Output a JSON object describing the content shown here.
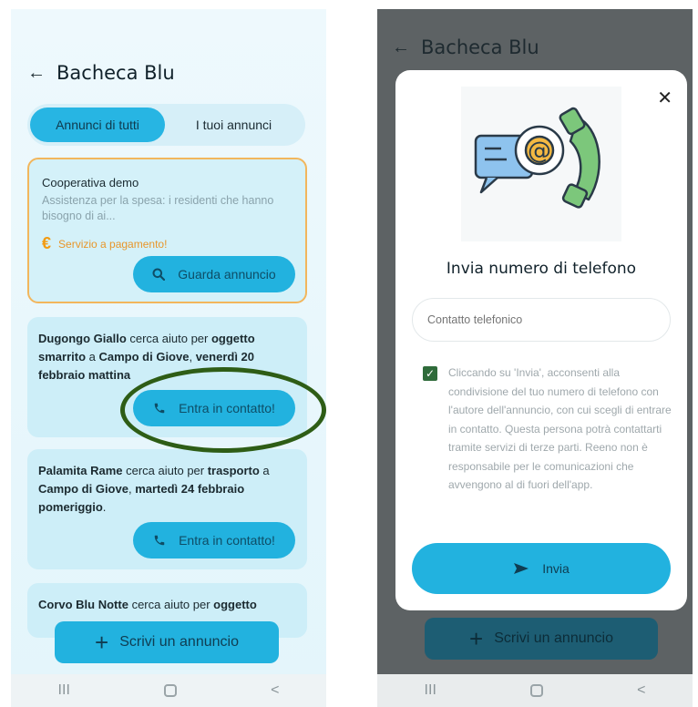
{
  "left": {
    "header": {
      "back_icon": "arrow-left-icon",
      "title": "Bacheca Blu"
    },
    "tabs": [
      {
        "label": "Annunci di tutti",
        "active": true
      },
      {
        "label": "I tuoi annunci",
        "active": false
      }
    ],
    "cards": {
      "coop": {
        "title": "Cooperativa demo",
        "desc": "Assistenza per la spesa: i residenti che hanno bisogno di ai...",
        "paid_label": "Servizio a pagamento!",
        "paid_icon": "euro-icon",
        "button": "Guarda annuncio",
        "button_icon": "search-icon"
      },
      "dugongo": {
        "name": "Dugongo Giallo",
        "mid1": " cerca aiuto per ",
        "item": "oggetto smarrito",
        "mid2": " a ",
        "place": "Campo di Giove",
        "mid3": ", ",
        "when": "venerdì 20 febbraio mattina",
        "end": "",
        "button": "Entra in contatto!",
        "button_icon": "phone-icon"
      },
      "palamita": {
        "name": "Palamita Rame",
        "mid1": " cerca aiuto per ",
        "item": "trasporto",
        "mid2": " a ",
        "place": "Campo di Giove",
        "mid3": ", ",
        "when": "martedì 24 febbraio pomeriggio",
        "end": ".",
        "button": "Entra in contatto!",
        "button_icon": "phone-icon"
      },
      "corvo": {
        "name": "Corvo Blu Notte",
        "mid1": " cerca aiuto per ",
        "item": "oggetto"
      }
    },
    "write_button": "Scrivi un annuncio",
    "navbar": {
      "recent": "III",
      "back": "<"
    }
  },
  "right": {
    "header": {
      "title": "Bacheca Blu"
    },
    "modal": {
      "close_icon": "close-icon",
      "illustration": "contact-illustration",
      "title": "Invia numero di telefono",
      "input_placeholder": "Contatto telefonico",
      "consent_checked": true,
      "consent_text": "Cliccando su 'Invia', acconsenti alla condivisione del tuo numero di telefono con l'autore dell'annuncio, con cui scegli di entrare in contatto. Questa persona potrà contattarti tramite servizi di terze parti. Reeno non è responsabile per le comunicazioni che avvengono al di fuori dell'app.",
      "send_button": "Invia",
      "send_icon": "send-icon"
    },
    "write_button": "Scrivi un annuncio"
  },
  "colors": {
    "primary": "#22b2df",
    "paid_border": "#f2b65c",
    "highlight": "#2e5d16",
    "overlay": "#5d6264"
  }
}
